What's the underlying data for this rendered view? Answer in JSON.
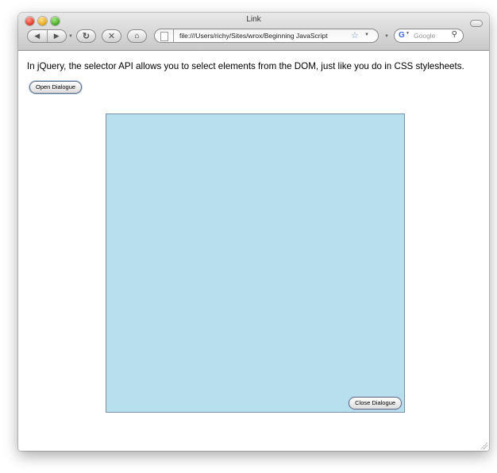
{
  "window": {
    "title": "Link"
  },
  "toolbar": {
    "back_icon": "back-arrow-icon",
    "forward_icon": "forward-arrow-icon",
    "reload_icon": "reload-icon",
    "stop_icon": "stop-icon",
    "home_icon": "home-icon",
    "url": "file:///Users/richy/Sites/wrox/Beginning JavaScript",
    "search_engine": "G",
    "search_placeholder": "Google"
  },
  "page": {
    "intro_text": "In jQuery, the selector API allows you to select elements from the DOM, just like you do in CSS stylesheets.",
    "open_button_label": "Open Dialogue",
    "close_button_label": "Close Dialogue"
  },
  "colors": {
    "dialog_background": "#b8dfee",
    "dialog_border": "#7b8fa6"
  }
}
